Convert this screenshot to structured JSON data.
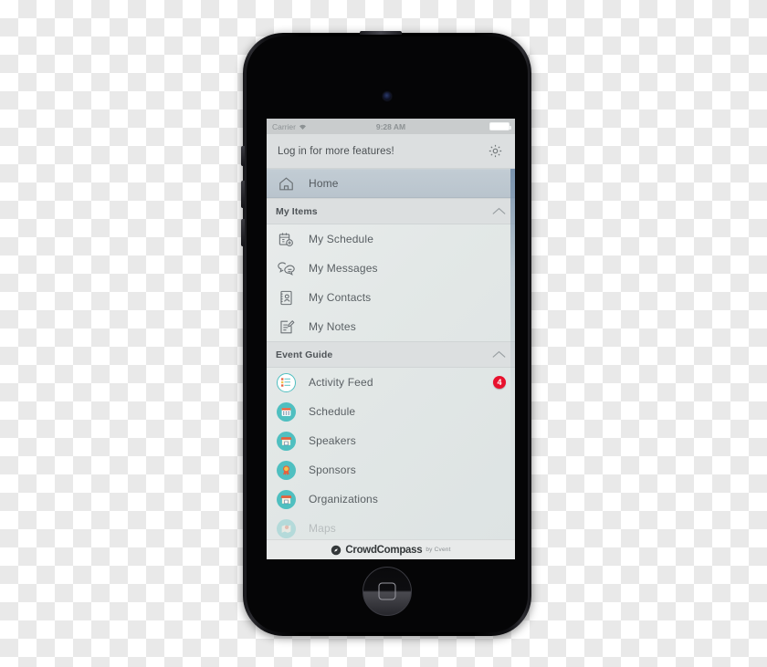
{
  "device": {
    "name": "iphone-mockup",
    "home_button_glyph": "rounded-square"
  },
  "status_bar": {
    "carrier": "Carrier",
    "wifi_icon": "wifi-icon",
    "time": "9:28 AM",
    "battery_icon": "battery-full-icon"
  },
  "header": {
    "login_prompt": "Log in for more features!",
    "settings_icon": "gear-icon"
  },
  "drawer": {
    "home": {
      "label": "Home",
      "icon": "home-icon"
    },
    "sections": [
      {
        "title": "My Items",
        "collapse_icon": "chevron-up-icon",
        "items": [
          {
            "label": "My Schedule",
            "icon": "calendar-add-icon"
          },
          {
            "label": "My Messages",
            "icon": "chat-bubbles-icon"
          },
          {
            "label": "My Contacts",
            "icon": "contact-card-icon"
          },
          {
            "label": "My Notes",
            "icon": "note-pencil-icon"
          }
        ]
      },
      {
        "title": "Event Guide",
        "collapse_icon": "chevron-up-icon",
        "items": [
          {
            "label": "Activity Feed",
            "icon": "activity-feed-icon",
            "badge": "4"
          },
          {
            "label": "Schedule",
            "icon": "calendar-icon"
          },
          {
            "label": "Speakers",
            "icon": "storefront-icon"
          },
          {
            "label": "Sponsors",
            "icon": "award-ribbon-icon"
          },
          {
            "label": "Organizations",
            "icon": "storefront-icon"
          },
          {
            "label": "Maps",
            "icon": "map-pin-icon"
          }
        ]
      }
    ]
  },
  "footer": {
    "logo_icon": "compass-icon",
    "brand": "CrowdCompass",
    "byline": "by Cvent"
  },
  "colors": {
    "accent_teal": "#4fbfc0",
    "badge_red": "#e8112d",
    "header_gray": "#dcdfe0",
    "home_highlight": "#bdc7d0"
  }
}
